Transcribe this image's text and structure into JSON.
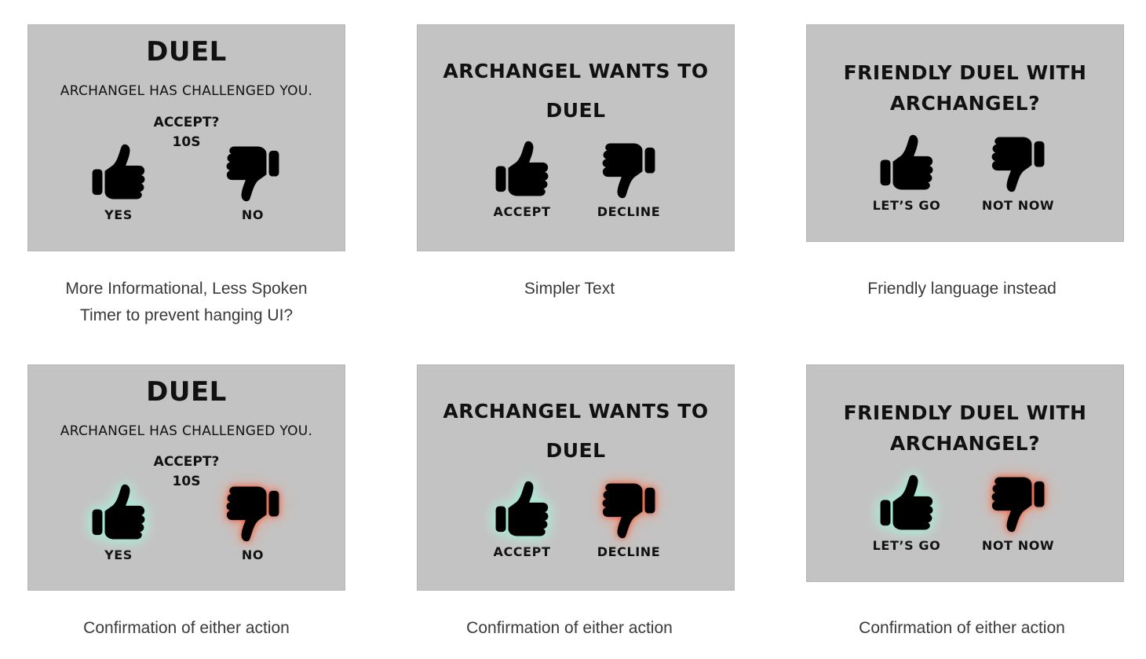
{
  "panels": [
    {
      "title": "DUEL",
      "subtitle": "ARCHANGEL HAS CHALLENGED YOU.",
      "prompt": "ACCEPT?",
      "timer": "10S",
      "yes_label": "YES",
      "no_label": "NO",
      "caption_line1": "More Informational, Less Spoken",
      "caption_line2": "Timer to prevent hanging UI?"
    },
    {
      "title_line1": "ARCHANGEL WANTS TO",
      "title_line2": "DUEL",
      "yes_label": "ACCEPT",
      "no_label": "DECLINE",
      "caption_line1": "Simpler Text"
    },
    {
      "title_line1": "FRIENDLY DUEL WITH",
      "title_line2": "ARCHANGEL?",
      "yes_label": "LET’S GO",
      "no_label": "NOT NOW",
      "caption_line1": "Friendly language instead"
    },
    {
      "title": "DUEL",
      "subtitle": "ARCHANGEL HAS CHALLENGED YOU.",
      "prompt": "ACCEPT?",
      "timer": "10S",
      "yes_label": "YES",
      "no_label": "NO",
      "caption_line1": "Confirmation of either action"
    },
    {
      "title_line1": "ARCHANGEL WANTS TO",
      "title_line2": "DUEL",
      "yes_label": "ACCEPT",
      "no_label": "DECLINE",
      "caption_line1": "Confirmation of either action"
    },
    {
      "title_line1": "FRIENDLY DUEL WITH",
      "title_line2": "ARCHANGEL?",
      "yes_label": "LET’S GO",
      "no_label": "NOT NOW",
      "caption_line1": "Confirmation of either action"
    }
  ],
  "icons": {
    "yes": "thumbs-up-icon",
    "no": "thumbs-down-icon"
  },
  "colors": {
    "panel_bg": "#c3c3c3",
    "icon": "#000000",
    "glow_yes": "#9de8d2",
    "glow_no": "#e4583a",
    "caption_text": "#3a3a3a"
  }
}
